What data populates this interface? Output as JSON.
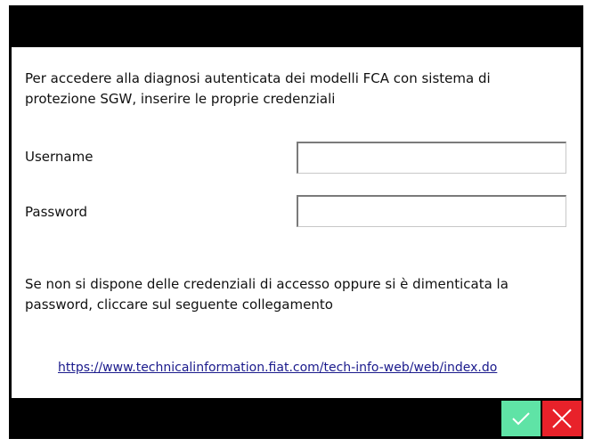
{
  "dialog": {
    "intro_text": "Per accedere alla diagnosi autenticata dei modelli FCA con sistema di protezione SGW, inserire le proprie credenziali",
    "username_label": "Username",
    "username_value": "",
    "password_label": "Password",
    "password_value": "",
    "info_text": "Se non si dispone delle credenziali di accesso oppure si è dimenticata la password, cliccare sul seguente collegamento",
    "link_text": "https://www.technicalinformation.fiat.com/tech-info-web/web/index.do"
  },
  "footer": {
    "confirm_icon": "checkmark-icon",
    "cancel_icon": "close-icon"
  },
  "colors": {
    "frame": "#000000",
    "confirm": "#5fe3a6",
    "cancel": "#e8222a",
    "link": "#1a1a8c"
  }
}
